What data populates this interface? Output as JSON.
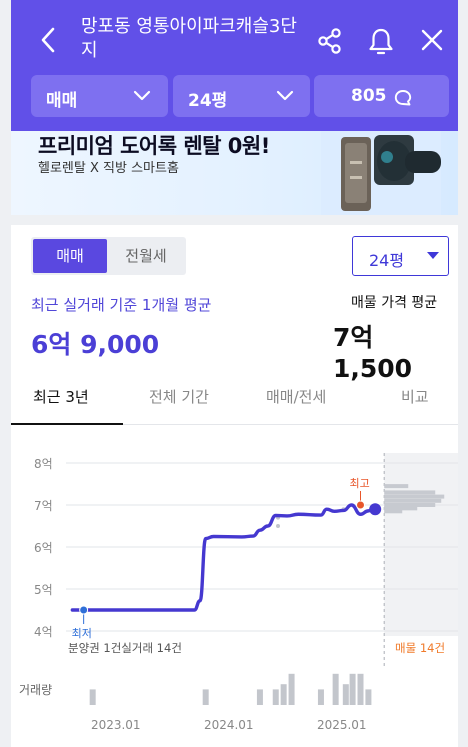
{
  "header": {
    "title": "망포동 영통아이파크캐슬3단지",
    "filters": {
      "trade_type": "매매",
      "size": "24평",
      "talk_count": "805"
    }
  },
  "banner": {
    "title": "프리미엄 도어록 렌탈 0원!",
    "subtitle": "헬로렌탈 X 직방 스마트홈"
  },
  "summary": {
    "toggle": {
      "trade": "매매",
      "rent": "전월세"
    },
    "size_select": "24평",
    "recent_avg_label": "최근 실거래 기준 1개월 평균",
    "recent_avg_value": "6억 9,000",
    "listing_avg_label": "매물 가격 평균",
    "listing_avg_value": "7억 1,500"
  },
  "tabs": [
    "최근 3년",
    "전체 기간",
    "매매/전세",
    "비교"
  ],
  "colors": {
    "header": "#6150e8",
    "accent": "#4b3fd6",
    "line": "#4538d0",
    "highest": "#e8562a",
    "listing": "#f07a2a",
    "lowest": "#2f6fd8"
  },
  "chart_data": {
    "type": "line",
    "x_tick_labels": [
      "2023.01",
      "2024.01",
      "2025.01"
    ],
    "y_tick_labels": [
      "8억",
      "7억",
      "6억",
      "5억",
      "4억"
    ],
    "ylim": [
      4,
      8
    ],
    "y_unit": "억",
    "series": [
      {
        "values": [
          {
            "t": 2022.8,
            "v": 4.5
          },
          {
            "t": 2023.0,
            "v": 4.5
          },
          {
            "t": 2023.5,
            "v": 4.5
          },
          {
            "t": 2023.88,
            "v": 4.5
          },
          {
            "t": 2023.93,
            "v": 4.72
          },
          {
            "t": 2023.98,
            "v": 6.2
          },
          {
            "t": 2024.05,
            "v": 6.25
          },
          {
            "t": 2024.3,
            "v": 6.24
          },
          {
            "t": 2024.4,
            "v": 6.26
          },
          {
            "t": 2024.46,
            "v": 6.4
          },
          {
            "t": 2024.53,
            "v": 6.5
          },
          {
            "t": 2024.6,
            "v": 6.75
          },
          {
            "t": 2024.7,
            "v": 6.74
          },
          {
            "t": 2024.8,
            "v": 6.78
          },
          {
            "t": 2025.0,
            "v": 6.76
          },
          {
            "t": 2025.05,
            "v": 6.9
          },
          {
            "t": 2025.12,
            "v": 6.85
          },
          {
            "t": 2025.2,
            "v": 6.87
          },
          {
            "t": 2025.27,
            "v": 7.0
          },
          {
            "t": 2025.35,
            "v": 6.78
          },
          {
            "t": 2025.42,
            "v": 6.86
          },
          {
            "t": 2025.46,
            "v": 6.9
          }
        ]
      }
    ],
    "lowest": {
      "label": "최저",
      "t": 2022.9,
      "v": 4.5
    },
    "highest": {
      "label": "최고",
      "t": 2025.35,
      "v": 7.0
    },
    "current_point": {
      "t": 2025.48,
      "v": 6.9
    },
    "listing_distribution": [
      {
        "v": 7.45,
        "w": 0.4
      },
      {
        "v": 7.3,
        "w": 0.85
      },
      {
        "v": 7.2,
        "w": 1.0
      },
      {
        "v": 7.1,
        "w": 0.95
      },
      {
        "v": 7.0,
        "w": 0.85
      },
      {
        "v": 6.92,
        "w": 0.55
      },
      {
        "v": 6.85,
        "w": 0.3
      }
    ],
    "volume": [
      {
        "t": 2022.98,
        "v": 3
      },
      {
        "t": 2023.98,
        "v": 3
      },
      {
        "t": 2024.46,
        "v": 3
      },
      {
        "t": 2024.6,
        "v": 3
      },
      {
        "t": 2024.67,
        "v": 4
      },
      {
        "t": 2024.74,
        "v": 6
      },
      {
        "t": 2025.0,
        "v": 3
      },
      {
        "t": 2025.13,
        "v": 6
      },
      {
        "t": 2025.22,
        "v": 4
      },
      {
        "t": 2025.28,
        "v": 6
      },
      {
        "t": 2025.35,
        "v": 6
      },
      {
        "t": 2025.42,
        "v": 3
      }
    ],
    "legend_left": "분양권 1건실거래 14건",
    "legend_right": "매물 14건",
    "volume_label": "거래량"
  }
}
